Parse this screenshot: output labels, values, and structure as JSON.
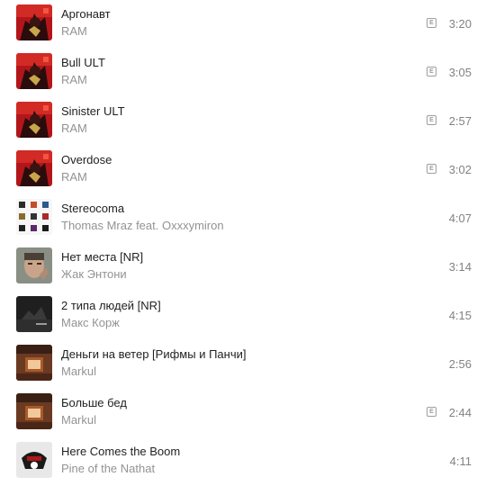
{
  "tracks": [
    {
      "title": "Аргонавт",
      "artist": "RAM",
      "duration": "3:20",
      "explicit": true,
      "explicit_label": "E",
      "cover_icon": "ram-album-cover"
    },
    {
      "title": "Bull ULT",
      "artist": "RAM",
      "duration": "3:05",
      "explicit": true,
      "explicit_label": "E",
      "cover_icon": "ram-album-cover"
    },
    {
      "title": "Sinister ULT",
      "artist": "RAM",
      "duration": "2:57",
      "explicit": true,
      "explicit_label": "E",
      "cover_icon": "ram-album-cover"
    },
    {
      "title": "Overdose",
      "artist": "RAM",
      "duration": "3:02",
      "explicit": true,
      "explicit_label": "E",
      "cover_icon": "ram-album-cover"
    },
    {
      "title": "Stereocoma",
      "artist": "Thomas Mraz feat. Oxxxymiron",
      "duration": "4:07",
      "explicit": false,
      "cover_icon": "grid-album-cover"
    },
    {
      "title": "Нет места [NR]",
      "artist": "Жак Энтони",
      "duration": "3:14",
      "explicit": false,
      "cover_icon": "face-album-cover"
    },
    {
      "title": "2 типа людей [NR]",
      "artist": "Макс Корж",
      "duration": "4:15",
      "explicit": false,
      "cover_icon": "dark-album-cover"
    },
    {
      "title": "Деньги на ветер [Рифмы и Панчи]",
      "artist": "Markul",
      "duration": "2:56",
      "explicit": false,
      "cover_icon": "room-album-cover"
    },
    {
      "title": "Больше бед",
      "artist": "Markul",
      "duration": "2:44",
      "explicit": true,
      "explicit_label": "E",
      "cover_icon": "room-album-cover"
    },
    {
      "title": "Here Comes the Boom",
      "artist": "Pine of the Nathat",
      "duration": "4:11",
      "explicit": false,
      "cover_icon": "skull-album-cover"
    }
  ]
}
